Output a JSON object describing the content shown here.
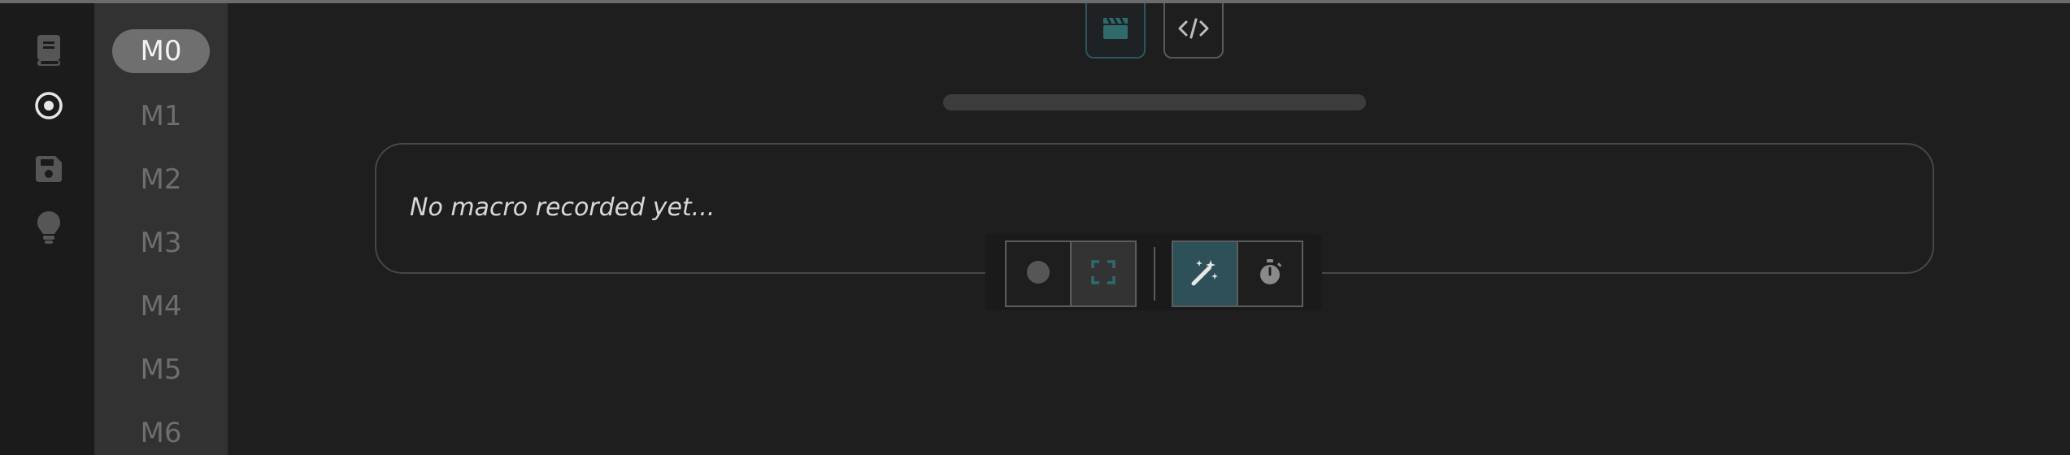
{
  "rail": {
    "items": [
      {
        "icon": "book-icon",
        "active": false
      },
      {
        "icon": "record-target-icon",
        "active": true
      },
      {
        "icon": "save-icon",
        "active": false
      },
      {
        "icon": "lightbulb-icon",
        "active": false
      }
    ]
  },
  "slots": {
    "items": [
      "M0",
      "M1",
      "M2",
      "M3",
      "M4",
      "M5",
      "M6"
    ],
    "active": "M0"
  },
  "top_toolbar": {
    "buttons": [
      {
        "icon": "clapperboard-icon",
        "active": true
      },
      {
        "icon": "code-icon",
        "active": false
      }
    ]
  },
  "progress": {
    "value": 0
  },
  "macro": {
    "empty_text": "No macro recorded yet..."
  },
  "bottom_toolbar": {
    "buttons": [
      {
        "icon": "record-icon",
        "active": false
      },
      {
        "icon": "focus-frame-icon",
        "active": false
      },
      {
        "icon": "magic-wand-icon",
        "active": true
      },
      {
        "icon": "stopwatch-icon",
        "active": false
      }
    ]
  },
  "colors": {
    "accent": "#2d5059",
    "accent_icon": "#2f6b6b",
    "background": "#1e1e1e",
    "slot_column": "#323232",
    "active_slot": "#6f6f6f"
  }
}
